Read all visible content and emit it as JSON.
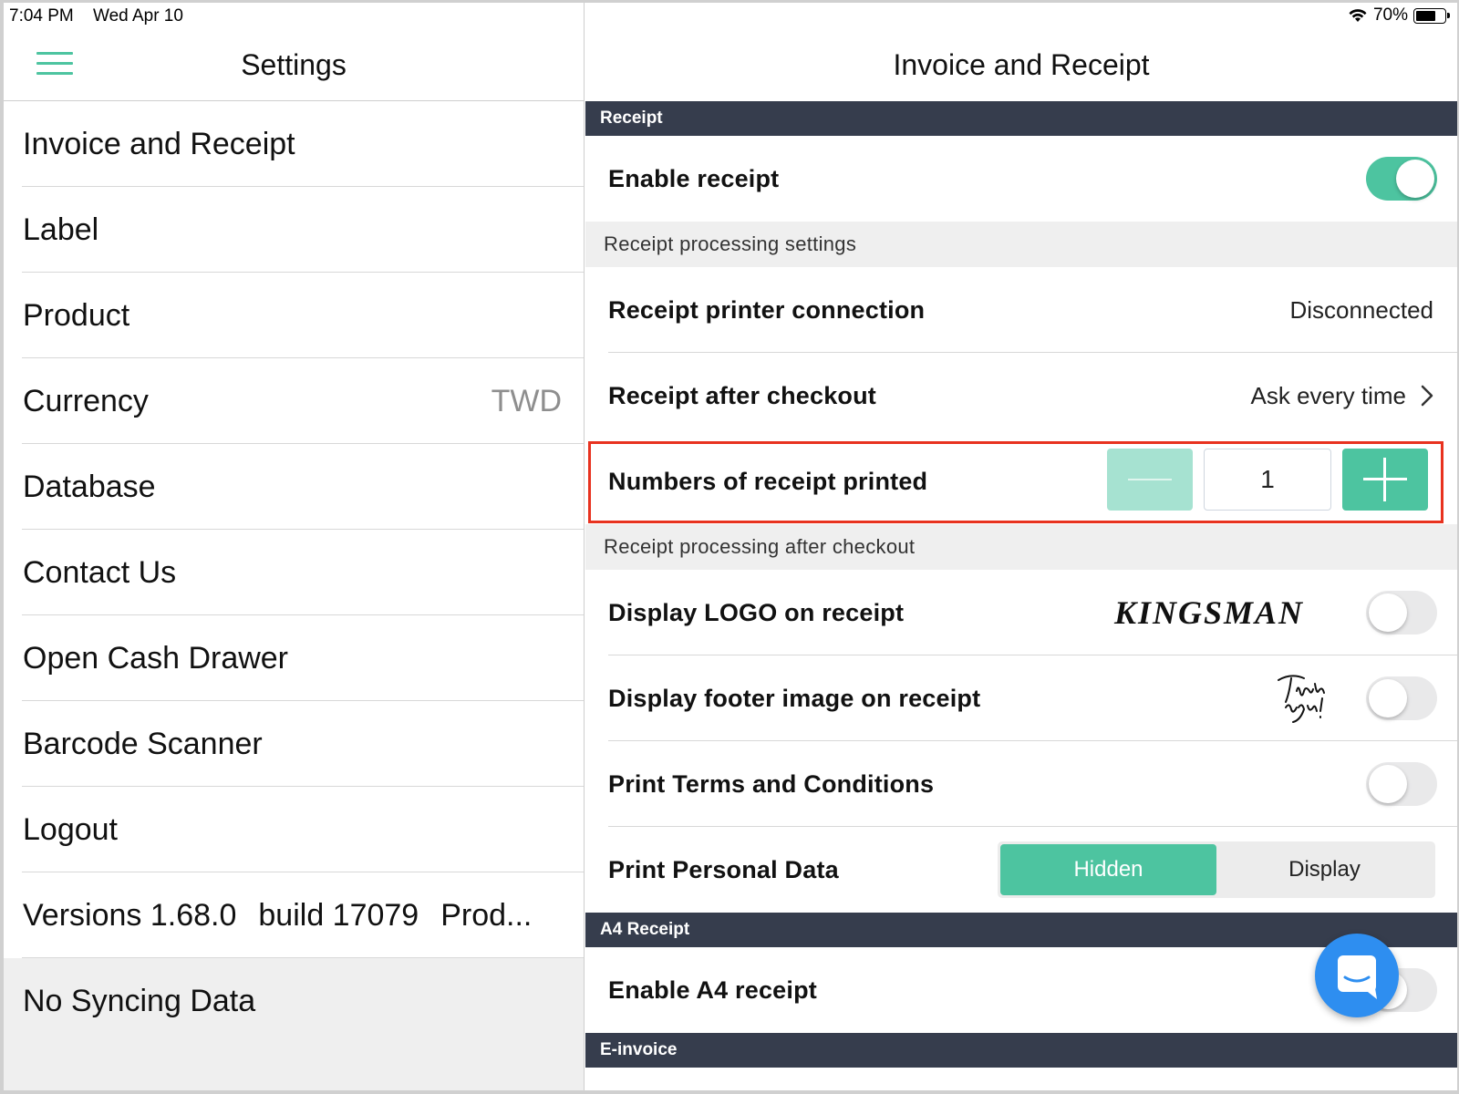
{
  "status_bar": {
    "time": "7:04 PM",
    "date": "Wed Apr 10",
    "battery": "70%",
    "battery_level": 0.7
  },
  "left": {
    "title": "Settings",
    "menu": [
      {
        "label": "Invoice and Receipt",
        "value": ""
      },
      {
        "label": "Label",
        "value": ""
      },
      {
        "label": "Product",
        "value": ""
      },
      {
        "label": "Currency",
        "value": "TWD"
      },
      {
        "label": "Database",
        "value": ""
      },
      {
        "label": "Contact Us",
        "value": ""
      },
      {
        "label": "Open Cash Drawer",
        "value": ""
      },
      {
        "label": "Barcode Scanner",
        "value": ""
      },
      {
        "label": "Logout",
        "value": ""
      }
    ],
    "versions": {
      "version": "Versions 1.68.0",
      "build": "build 17079",
      "env": "Prod..."
    },
    "syncing": "No Syncing Data"
  },
  "right": {
    "title": "Invoice and Receipt",
    "section_receipt": "Receipt",
    "enable_receipt": {
      "label": "Enable receipt",
      "on": true
    },
    "processing_settings": "Receipt processing settings",
    "printer_connection": {
      "label": "Receipt printer connection",
      "value": "Disconnected"
    },
    "after_checkout": {
      "label": "Receipt after checkout",
      "value": "Ask every time"
    },
    "numbers_printed": {
      "label": "Numbers of receipt printed",
      "value": "1"
    },
    "processing_after": "Receipt processing after checkout",
    "display_logo": {
      "label": "Display LOGO on receipt",
      "logo_text": "KINGSMAN",
      "on": false
    },
    "display_footer": {
      "label": "Display footer image on receipt",
      "image_text": "Thank you!",
      "on": false
    },
    "print_terms": {
      "label": "Print Terms and Conditions",
      "on": false
    },
    "print_personal": {
      "label": "Print Personal Data",
      "options": [
        "Hidden",
        "Display"
      ],
      "selected": "Hidden"
    },
    "section_a4": "A4 Receipt",
    "enable_a4": {
      "label": "Enable A4 receipt",
      "on": false
    },
    "section_einvoice": "E-invoice"
  },
  "colors": {
    "accent": "#4dc4a0",
    "section_bar": "#363d4d",
    "highlight": "#e8321f",
    "chat": "#2e8ef0"
  },
  "icons": {
    "menu": "hamburger-icon",
    "chevron": "chevron-right-icon",
    "chat": "chat-bubble-icon",
    "wifi": "wifi-icon",
    "battery": "battery-icon"
  }
}
